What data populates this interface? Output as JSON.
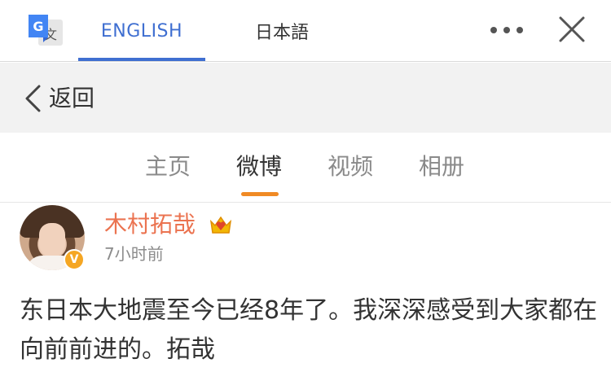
{
  "translate_bar": {
    "tab_english": "ENGLISH",
    "tab_japanese": "日本語",
    "logo_icon": "google-translate-icon",
    "more_icon": "more-horizontal-icon",
    "close_icon": "close-icon",
    "accent_color": "#3f6fd1"
  },
  "back_bar": {
    "back_label": "返回",
    "back_icon": "chevron-left-icon"
  },
  "profile_tabs": {
    "items": [
      {
        "label": "主页"
      },
      {
        "label": "微博"
      },
      {
        "label": "视频"
      },
      {
        "label": "相册"
      }
    ],
    "active": "微博",
    "indicator_color": "#f08a24"
  },
  "post": {
    "username": "木村拓哉",
    "timestamp": "7小时前",
    "verified_badge": "V",
    "vip_icon": "vip-crown-icon",
    "text": "东日本大地震至今已经8年了。我深深感受到大家都在向前前进的。拓哉",
    "username_color": "#eb7350"
  }
}
